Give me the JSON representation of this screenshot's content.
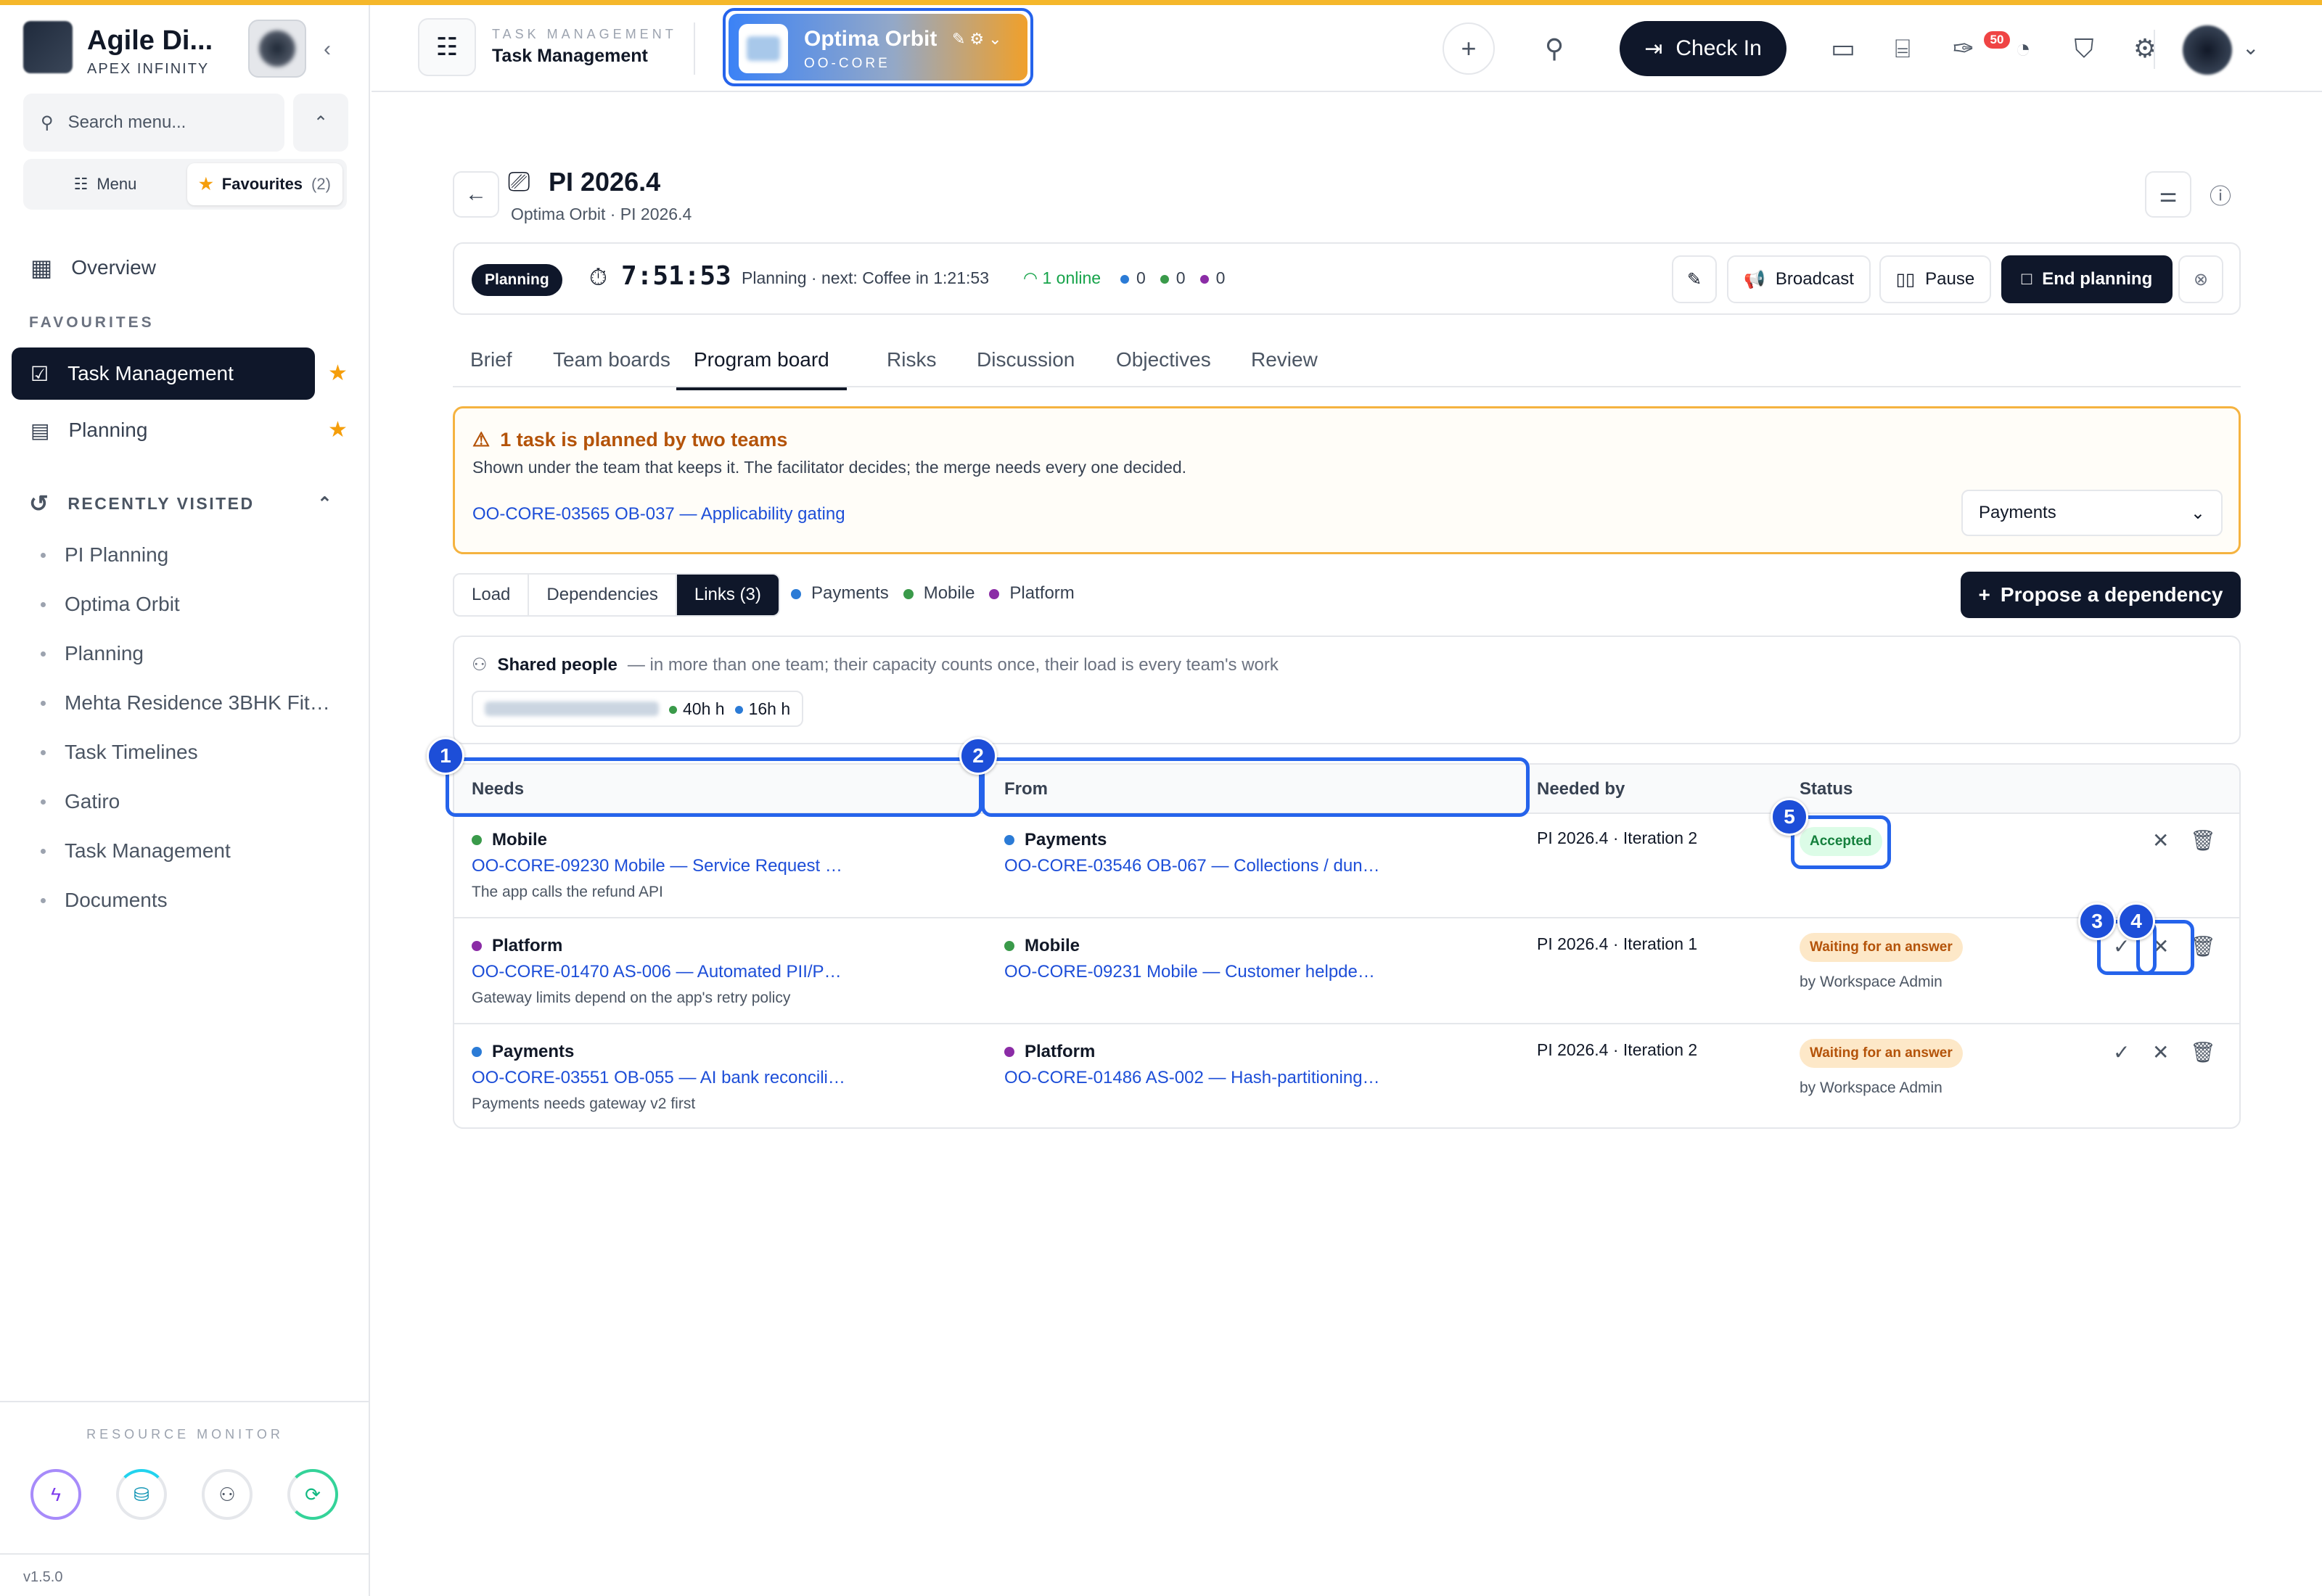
{
  "sidebar": {
    "brand": "Agile Di...",
    "brand_sub": "APEX INFINITY",
    "search_placeholder": "Search menu...",
    "seg_menu": "Menu",
    "seg_favourites": "Favourites",
    "seg_fav_count": "(2)",
    "overview": "Overview",
    "favourites_heading": "FAVOURITES",
    "favourites": [
      {
        "label": "Task Management",
        "icon": "checkbox-icon"
      },
      {
        "label": "Planning",
        "icon": "calendar-icon"
      }
    ],
    "recent_heading": "RECENTLY VISITED",
    "recent": [
      "PI Planning",
      "Optima Orbit",
      "Planning",
      "Mehta Residence 3BHK Fit…",
      "Task Timelines",
      "Gatiro",
      "Task Management",
      "Documents"
    ],
    "resource_monitor": "RESOURCE MONITOR",
    "version": "v1.5.0"
  },
  "header": {
    "module_kicker": "TASK MANAGEMENT",
    "module_name": "Task Management",
    "project_name": "Optima Orbit",
    "project_code": "OO-CORE",
    "checkin": "Check In",
    "notification_count": "50"
  },
  "pi": {
    "title": "PI 2026.4",
    "subtitle": "Optima Orbit · PI 2026.4",
    "status": "Planning",
    "timer": "7:51:53",
    "timer_note": "Planning · next: Coffee in 1:21:53",
    "online": "1 online",
    "counts": [
      "0",
      "0",
      "0"
    ],
    "broadcast": "Broadcast",
    "pause": "Pause",
    "end_planning": "End planning"
  },
  "tabs": [
    "Brief",
    "Team boards",
    "Program board",
    "Risks",
    "Discussion",
    "Objectives",
    "Review"
  ],
  "active_tab": "Program board",
  "alert": {
    "title": "1 task is planned by two teams",
    "description": "Shown under the team that keeps it. The facilitator decides; the merge needs every one decided.",
    "link": "OO-CORE-03565 OB-037 — Applicability gating",
    "select_value": "Payments"
  },
  "view_seg": [
    "Load",
    "Dependencies",
    "Links (3)"
  ],
  "legend": [
    {
      "name": "Payments",
      "color": "#2b7bd6"
    },
    {
      "name": "Mobile",
      "color": "#3a9a4a"
    },
    {
      "name": "Platform",
      "color": "#8b2ca6"
    }
  ],
  "propose": "Propose a dependency",
  "shared": {
    "title": "Shared people",
    "desc": "— in more than one team; their capacity counts once, their load is every team's work",
    "hours_a": "40h h",
    "hours_b": "16h h"
  },
  "table": {
    "headers": [
      "Needs",
      "From",
      "Needed by",
      "Status"
    ],
    "rows": [
      {
        "needs_team": "Mobile",
        "needs_color": "#3a9a4a",
        "needs_link": "OO-CORE-09230 Mobile — Service Request …",
        "needs_note": "The app calls the refund API",
        "from_team": "Payments",
        "from_color": "#2b7bd6",
        "from_link": "OO-CORE-03546 OB-067 — Collections / dun…",
        "needed_by": "PI 2026.4 · Iteration 2",
        "status": "Accepted",
        "by": ""
      },
      {
        "needs_team": "Platform",
        "needs_color": "#8b2ca6",
        "needs_link": "OO-CORE-01470 AS-006 — Automated PII/P…",
        "needs_note": "Gateway limits depend on the app's retry policy",
        "from_team": "Mobile",
        "from_color": "#3a9a4a",
        "from_link": "OO-CORE-09231 Mobile — Customer helpde…",
        "needed_by": "PI 2026.4 · Iteration 1",
        "status": "Waiting for an answer",
        "by": "by Workspace Admin"
      },
      {
        "needs_team": "Payments",
        "needs_color": "#2b7bd6",
        "needs_link": "OO-CORE-03551 OB-055 — AI bank reconcili…",
        "needs_note": "Payments needs gateway v2 first",
        "from_team": "Platform",
        "from_color": "#8b2ca6",
        "from_link": "OO-CORE-01486 AS-002 — Hash-partitioning…",
        "needed_by": "PI 2026.4 · Iteration 2",
        "status": "Waiting for an answer",
        "by": "by Workspace Admin"
      }
    ]
  },
  "markers": [
    "1",
    "2",
    "3",
    "4",
    "5"
  ]
}
